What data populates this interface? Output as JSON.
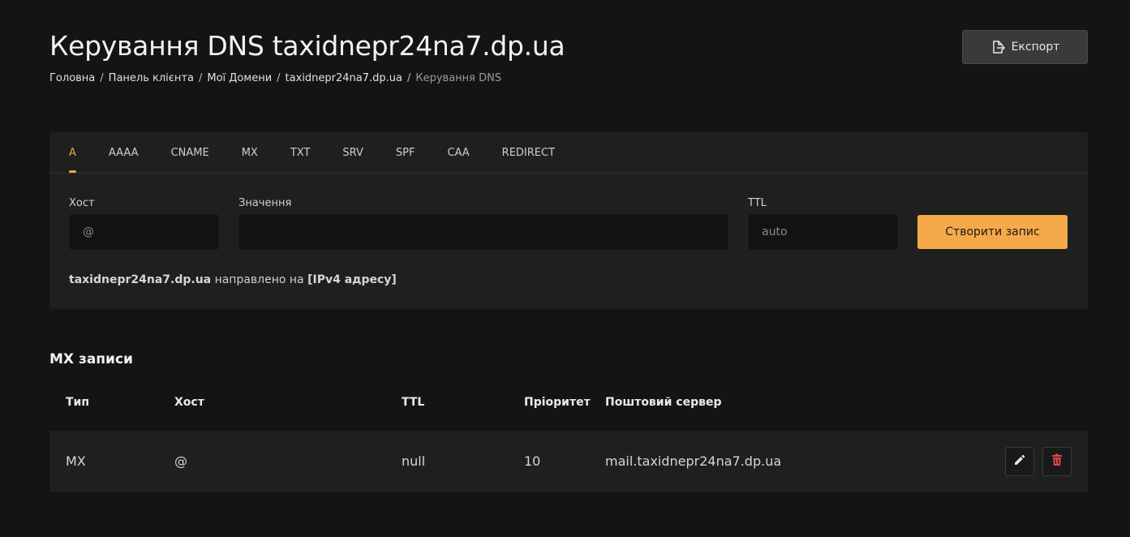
{
  "header": {
    "title": "Керування DNS taxidnepr24na7.dp.ua",
    "export_label": "Експорт"
  },
  "breadcrumb": {
    "items": [
      "Головна",
      "Панель клієнта",
      "Мої Домени",
      "taxidnepr24na7.dp.ua"
    ],
    "current": "Керування DNS",
    "separator": "/"
  },
  "tabs": [
    {
      "label": "A",
      "active": true
    },
    {
      "label": "AAAA"
    },
    {
      "label": "CNAME"
    },
    {
      "label": "MX"
    },
    {
      "label": "TXT"
    },
    {
      "label": "SRV"
    },
    {
      "label": "SPF"
    },
    {
      "label": "CAA"
    },
    {
      "label": "REDIRECT"
    }
  ],
  "form": {
    "host_label": "Хост",
    "host_placeholder": "@",
    "value_label": "Значення",
    "value_value": "",
    "ttl_label": "TTL",
    "ttl_placeholder": "auto",
    "create_label": "Створити запис",
    "hint_domain": "taxidnepr24na7.dp.ua",
    "hint_text": "направлено на",
    "hint_target": "[IPv4 адресу]"
  },
  "mx_section": {
    "title": "MX записи",
    "columns": [
      "Тип",
      "Хост",
      "TTL",
      "Пріоритет",
      "Поштовий сервер"
    ],
    "rows": [
      {
        "type": "MX",
        "host": "@",
        "ttl": "null",
        "priority": "10",
        "server": "mail.taxidnepr24na7.dp.ua"
      }
    ]
  },
  "colors": {
    "accent": "#f5a440",
    "background": "#141414",
    "card": "#1f1f1f",
    "delete": "#e0454a"
  },
  "icons": {
    "export": "export-icon",
    "edit": "pencil-icon",
    "delete": "trash-icon"
  }
}
